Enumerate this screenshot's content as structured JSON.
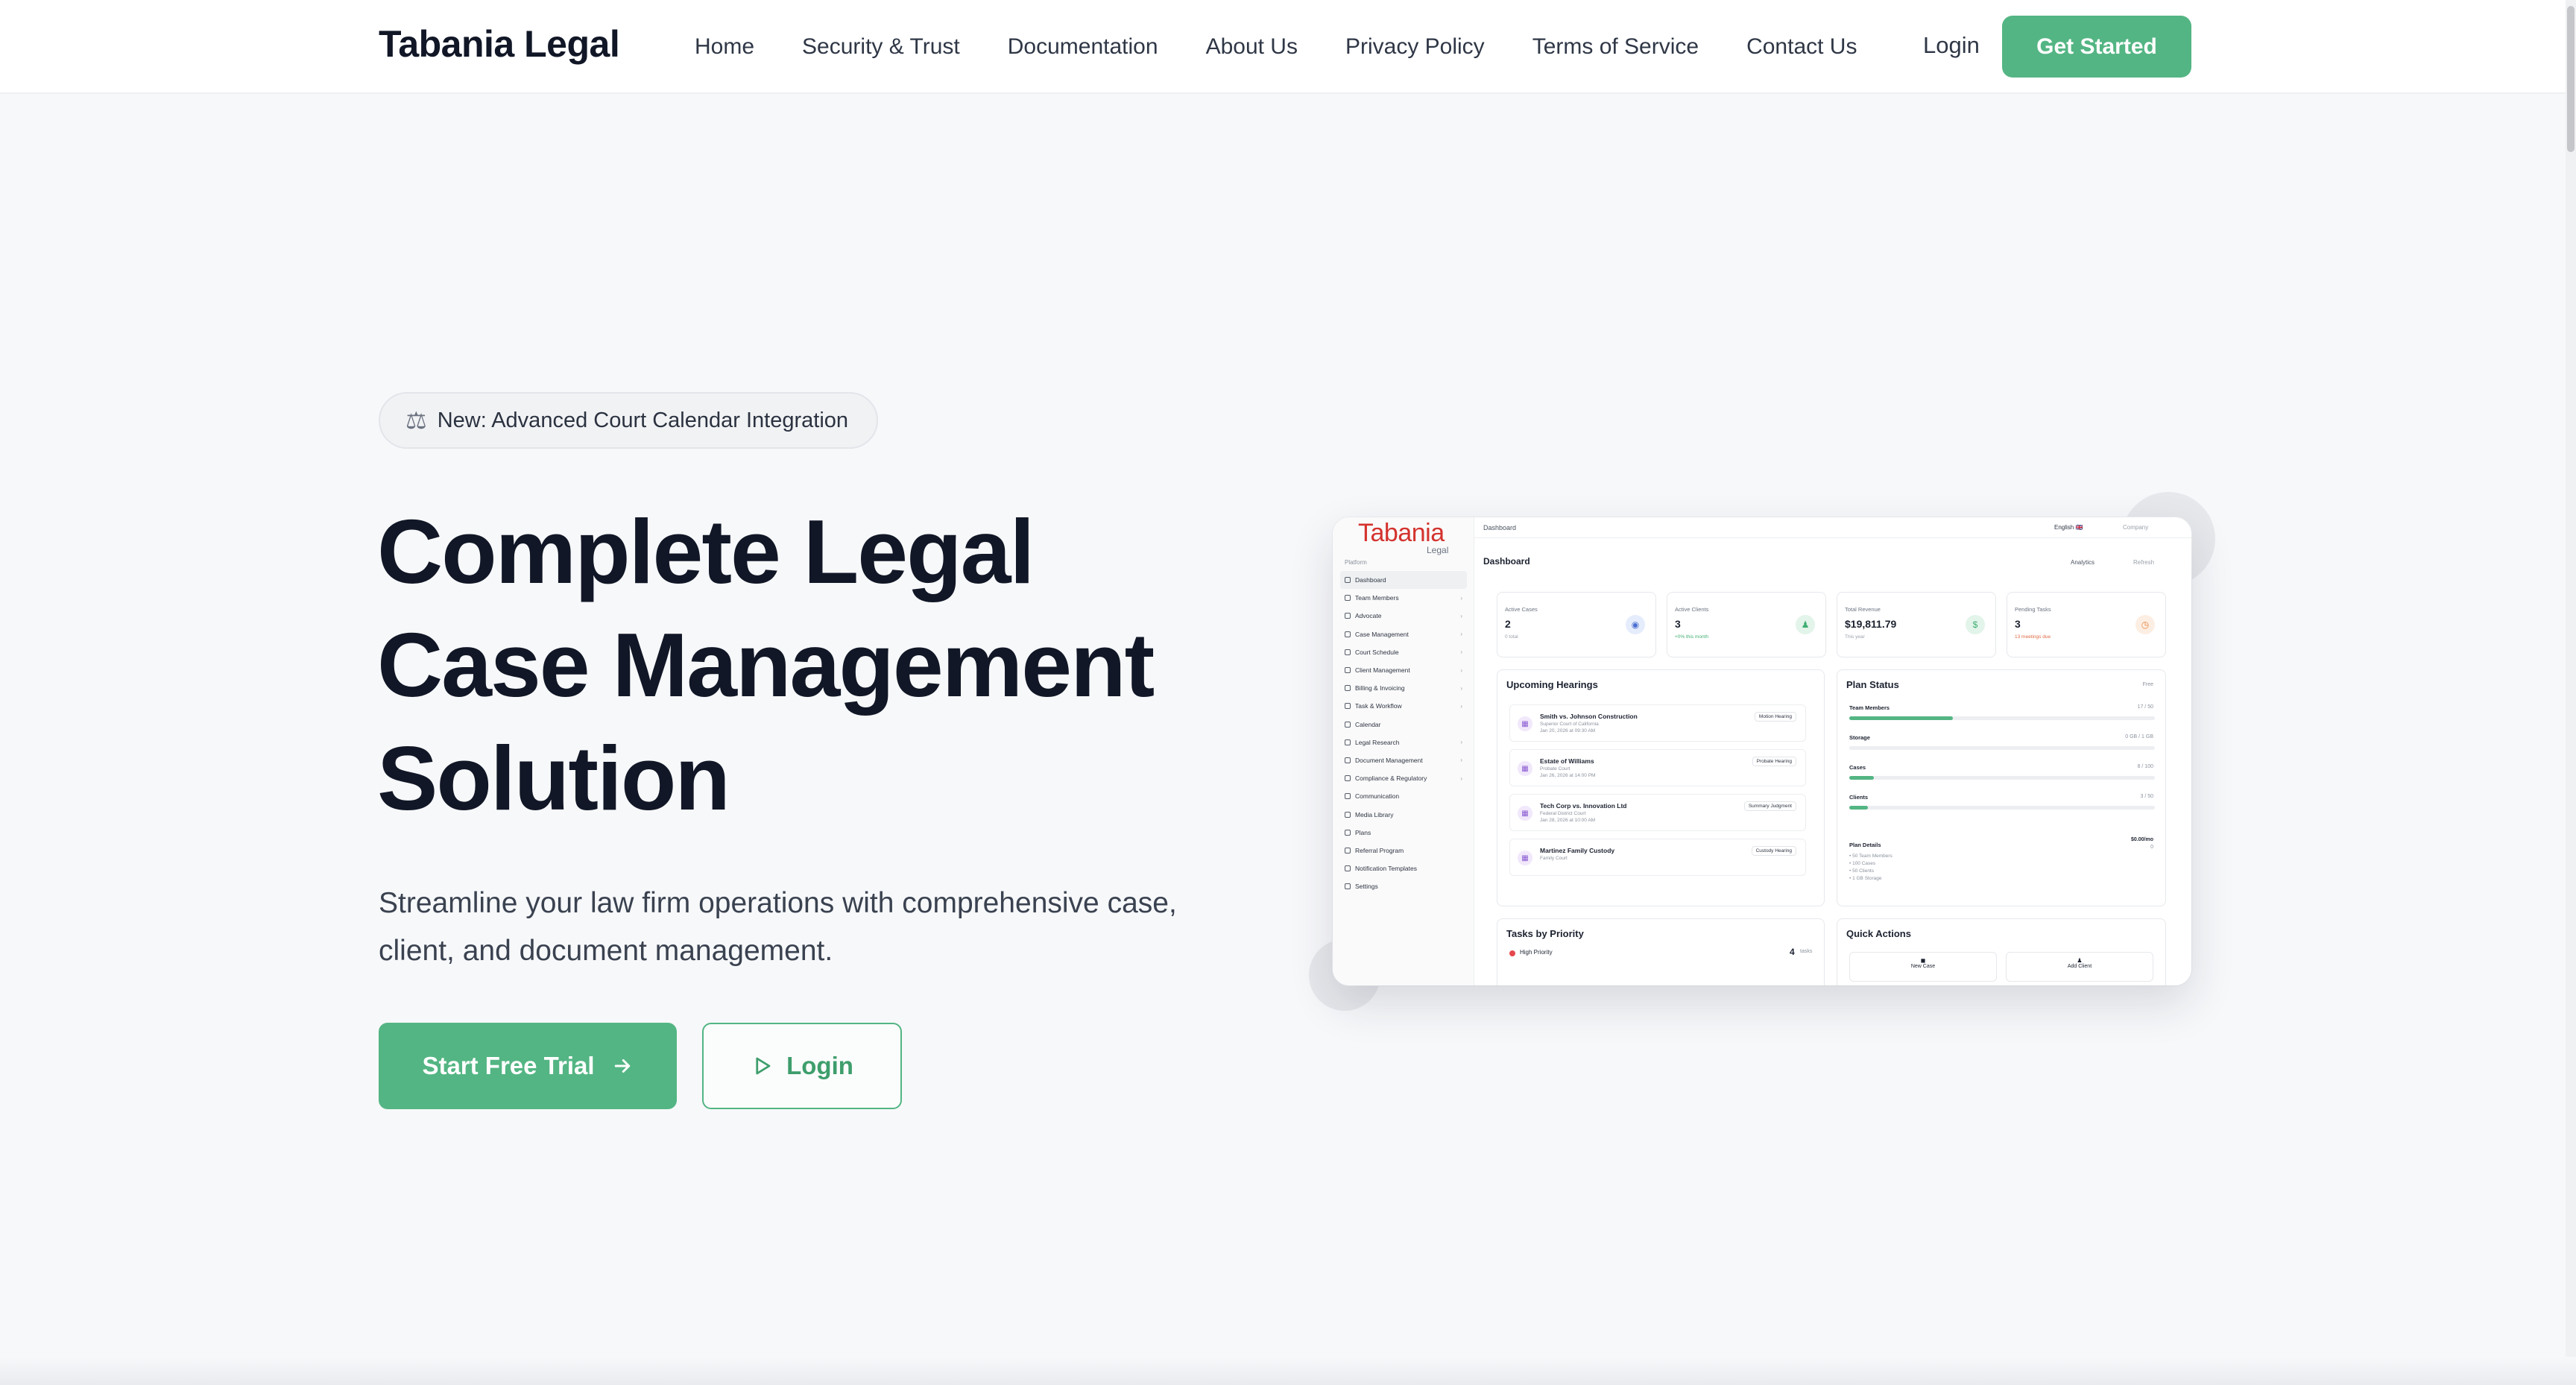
{
  "header": {
    "brand": "Tabania Legal",
    "nav": [
      "Home",
      "Security & Trust",
      "Documentation",
      "About Us",
      "Privacy Policy",
      "Terms of Service",
      "Contact Us"
    ],
    "login_label": "Login",
    "cta_label": "Get Started"
  },
  "hero": {
    "badge_icon": "scale-icon",
    "badge_text": "New: Advanced Court Calendar Integration",
    "title_lines": [
      "Complete Legal",
      "Case Management",
      "Solution"
    ],
    "subtitle_line1": "Streamline your law firm operations with comprehensive case,",
    "subtitle_line2": "client, and document management.",
    "primary_button": "Start Free Trial",
    "secondary_button": "Login"
  },
  "colors": {
    "accent": "#53b583",
    "brand_red": "#d4332e",
    "text": "#111726"
  },
  "dashboard_preview": {
    "logo": "Tabania",
    "logo_sub": "Legal",
    "section_label": "Platform",
    "breadcrumb": "Dashboard",
    "language": "English 🇬🇧",
    "company": "Company",
    "title": "Dashboard",
    "analytics": "Analytics",
    "refresh": "Refresh",
    "menu": [
      {
        "label": "Dashboard",
        "chevron": false
      },
      {
        "label": "Team Members",
        "chevron": true
      },
      {
        "label": "Advocate",
        "chevron": true
      },
      {
        "label": "Case Management",
        "chevron": true
      },
      {
        "label": "Court Schedule",
        "chevron": true
      },
      {
        "label": "Client Management",
        "chevron": true
      },
      {
        "label": "Billing & Invoicing",
        "chevron": true
      },
      {
        "label": "Task & Workflow",
        "chevron": true
      },
      {
        "label": "Calendar",
        "chevron": false
      },
      {
        "label": "Legal Research",
        "chevron": true
      },
      {
        "label": "Document Management",
        "chevron": true
      },
      {
        "label": "Compliance & Regulatory",
        "chevron": true
      },
      {
        "label": "Communication",
        "chevron": false
      },
      {
        "label": "Media Library",
        "chevron": false
      },
      {
        "label": "Plans",
        "chevron": false
      },
      {
        "label": "Referral Program",
        "chevron": false
      },
      {
        "label": "Notification Templates",
        "chevron": false
      },
      {
        "label": "Settings",
        "chevron": false
      }
    ],
    "stats": [
      {
        "label": "Active Cases",
        "value": "2",
        "sub": "0 total",
        "icon": "$",
        "tone": "blue"
      },
      {
        "label": "Active Clients",
        "value": "3",
        "sub": "+0% this month",
        "icon": "$",
        "tone": "green"
      },
      {
        "label": "Total Revenue",
        "value": "$19,811.79",
        "sub": "This year",
        "icon": "$",
        "tone": "green"
      },
      {
        "label": "Pending Tasks",
        "value": "3",
        "sub": "13 meetings due",
        "icon": "$",
        "tone": "orange"
      }
    ],
    "hearings_title": "Upcoming Hearings",
    "hearings": [
      {
        "title": "Smith vs. Johnson Construction",
        "court": "Superior Court of California",
        "date": "Jan 20, 2026 at 09:30 AM",
        "tag": "Motion Hearing"
      },
      {
        "title": "Estate of Williams",
        "court": "Probate Court",
        "date": "Jan 26, 2026 at 14:00 PM",
        "tag": "Probate Hearing"
      },
      {
        "title": "Tech Corp vs. Innovation Ltd",
        "court": "Federal District Court",
        "date": "Jan 28, 2026 at 10:00 AM",
        "tag": "Summary Judgment"
      },
      {
        "title": "Martinez Family Custody",
        "court": "Family Court",
        "date": "",
        "tag": "Custody Hearing"
      }
    ],
    "plan_title": "Plan Status",
    "plan_badge": "Free",
    "plan_rows": [
      {
        "label": "Team Members",
        "value": "17 / 50",
        "percent": 34
      },
      {
        "label": "Storage",
        "value": "0 GB / 1 GB",
        "percent": 0
      },
      {
        "label": "Cases",
        "value": "8 / 100",
        "percent": 8
      },
      {
        "label": "Clients",
        "value": "3 / 50",
        "percent": 6
      }
    ],
    "plan_details_label": "Plan Details",
    "plan_price": "$0.00/mo",
    "plan_price_sub": "0",
    "plan_details": [
      "• 50 Team Members",
      "• 100 Cases",
      "• 50 Clients",
      "• 1 GB Storage"
    ],
    "tasks_title": "Tasks by Priority",
    "tasks_row_label": "High Priority",
    "tasks_row_value": "4",
    "tasks_row_unit": "tasks",
    "quick_title": "Quick Actions",
    "quick_actions": [
      "New Case",
      "Add Client"
    ]
  }
}
